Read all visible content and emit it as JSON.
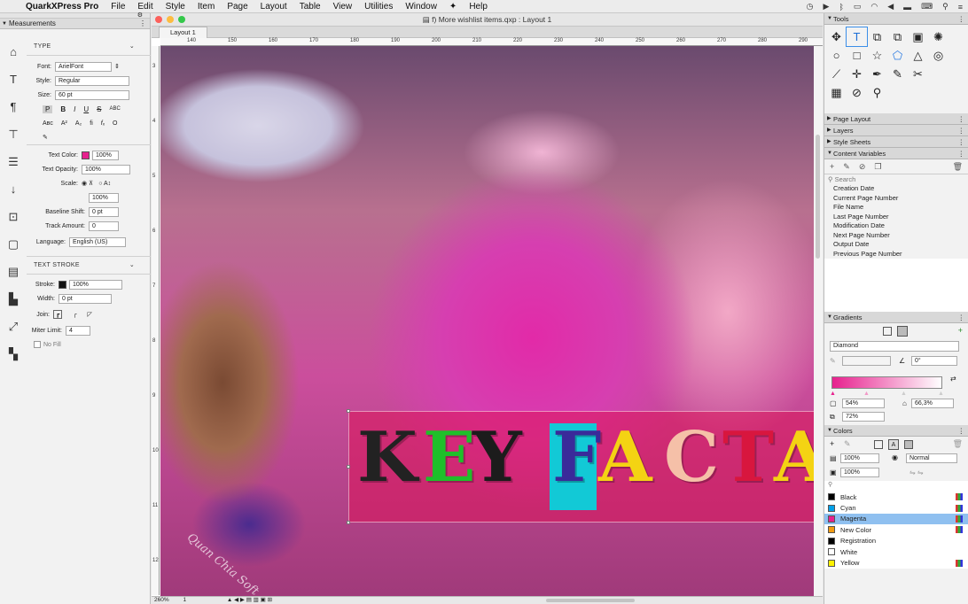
{
  "menubar": {
    "app": "QuarkXPress Pro",
    "items": [
      "File",
      "Edit",
      "Style",
      "Item",
      "Page",
      "Layout",
      "Table",
      "View",
      "Utilities",
      "Window",
      "Help"
    ]
  },
  "measurements": {
    "title": "Measurements",
    "type_section": "TYPE",
    "font_label": "Font:",
    "font_value": "ArielFont",
    "style_label": "Style:",
    "style_value": "Regular",
    "size_label": "Size:",
    "size_value": "60 pt",
    "text_color_label": "Text Color:",
    "text_color_value": "100%",
    "text_color_hex": "#e7218e",
    "text_opacity_label": "Text Opacity:",
    "text_opacity_value": "100%",
    "scale_label": "Scale:",
    "scale_value": "100%",
    "baseline_label": "Baseline Shift:",
    "baseline_value": "0 pt",
    "track_label": "Track Amount:",
    "track_value": "0",
    "language_label": "Language:",
    "language_value": "English (US)",
    "stroke_section": "TEXT STROKE",
    "stroke_label": "Stroke:",
    "stroke_value": "100%",
    "width_label": "Width:",
    "width_value": "0 pt",
    "join_label": "Join:",
    "miter_label": "Miter Limit:",
    "miter_value": "4",
    "nofill_label": "No Fill"
  },
  "document": {
    "title": "f) More wishlist items.qxp : Layout 1",
    "tab": "Layout 1",
    "ruler_h": [
      "140",
      "150",
      "160",
      "170",
      "180",
      "190",
      "200",
      "210",
      "220",
      "230",
      "240",
      "250",
      "260",
      "270",
      "280",
      "290"
    ],
    "ruler_v": [
      "3",
      "4",
      "5",
      "6",
      "7",
      "8",
      "9",
      "10",
      "11",
      "12"
    ],
    "zoom": "260%",
    "page": "1",
    "banner_letters": [
      {
        "ch": "K",
        "color": "#222222"
      },
      {
        "ch": "E",
        "color": "#1fbf2a"
      },
      {
        "ch": "Y",
        "color": "#1c1c1c"
      },
      {
        "ch": "F",
        "color": "#3a2a9a"
      },
      {
        "ch": "A",
        "color": "#f4d313"
      },
      {
        "ch": "C",
        "color": "#f5c0a8"
      },
      {
        "ch": "T",
        "color": "#d8163e"
      },
      {
        "ch": "A",
        "color": "#f4d313"
      }
    ],
    "watermark": "Quan Chia Soft"
  },
  "tools": {
    "title": "Tools",
    "icons": [
      "✥",
      "T",
      "⧉",
      "⧉",
      "▣",
      "✺",
      "○",
      "□",
      "☆",
      "⬠",
      "△",
      "◎",
      "⟋",
      "✛",
      "✒",
      "✎",
      "✂",
      "▦",
      "⊘",
      "⚲"
    ]
  },
  "panels": {
    "page_layout": "Page Layout",
    "layers": "Layers",
    "style_sheets": "Style Sheets",
    "content_variables": "Content Variables",
    "search": "Search",
    "cv_items": [
      "Creation Date",
      "Current Page Number",
      "File Name",
      "Last Page Number",
      "Modification Date",
      "Next Page Number",
      "Output Date",
      "Previous Page Number"
    ],
    "gradients": "Gradients",
    "gradient_type": "Diamond",
    "gradient_angle": "0°",
    "gradient_a": "54%",
    "gradient_b": "66,3%",
    "gradient_c": "72%",
    "colors": "Colors",
    "color_opacity_a": "100%",
    "color_mode": "Normal",
    "color_opacity_b": "100%",
    "color_items": [
      {
        "name": "Black",
        "hex": "#000000"
      },
      {
        "name": "Cyan",
        "hex": "#00a0e9"
      },
      {
        "name": "Magenta",
        "hex": "#e7218e"
      },
      {
        "name": "New Color",
        "hex": "#f39c12"
      },
      {
        "name": "Registration",
        "hex": "#000000"
      },
      {
        "name": "White",
        "hex": "#ffffff"
      },
      {
        "name": "Yellow",
        "hex": "#fff200"
      }
    ],
    "selected_color": "Magenta"
  }
}
